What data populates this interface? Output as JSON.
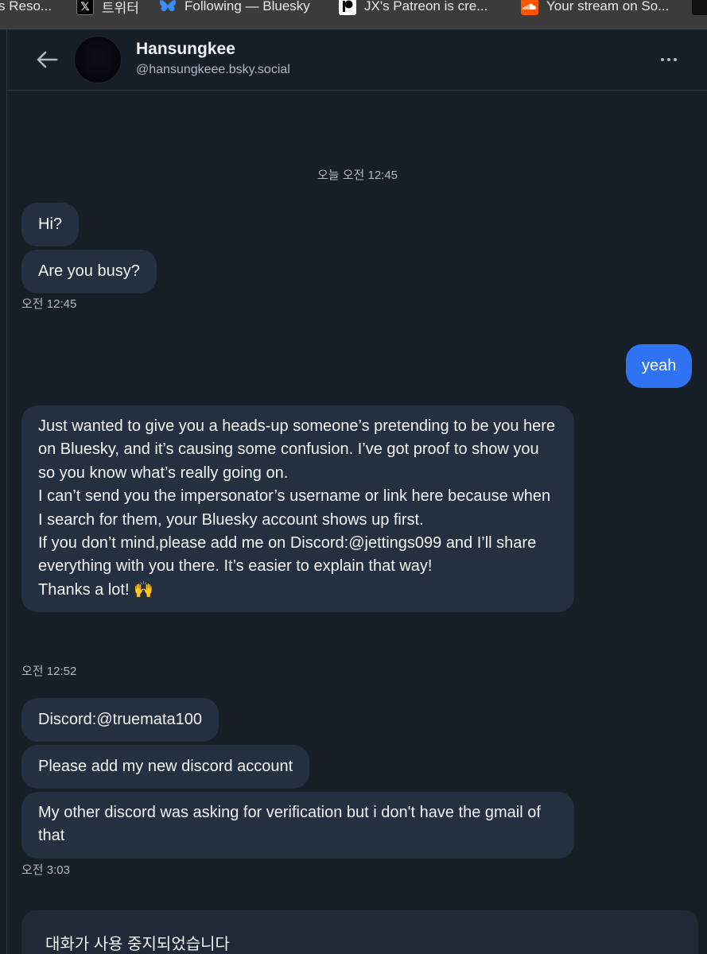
{
  "bookmarks": [
    {
      "label": "s Reso...",
      "icon": "dark-icon"
    },
    {
      "label": "트위터",
      "icon": "x-logo-icon"
    },
    {
      "label": "Following — Bluesky",
      "icon": "butterfly-icon"
    },
    {
      "label": "JX's Patreon is cre...",
      "icon": "patreon-icon"
    },
    {
      "label": "Your stream on So...",
      "icon": "soundcloud-icon"
    },
    {
      "label": "",
      "icon": "dark-icon"
    }
  ],
  "header": {
    "display_name": "Hansungkee",
    "handle": "@hansungkeee.bsky.social"
  },
  "conversation": {
    "date_divider": "오늘 오전 12:45",
    "messages": [
      {
        "from": "them",
        "text": "Hi?"
      },
      {
        "from": "them",
        "text": "Are you busy?"
      },
      {
        "from": "me",
        "text": "yeah"
      },
      {
        "from": "them",
        "text": "Just wanted to give you a heads-up someone’s pretending to be you here on Bluesky, and it’s causing some confusion. I’ve got proof to show you so you know what’s really going on.\nI can’t send you the impersonator’s username or link here because when I search for them, your Bluesky account shows up first.\nIf you don’t mind,please add me on Discord:@jettings099 and I’ll share everything with you there. It’s easier to explain that way!\nThanks a lot! 🙌"
      },
      {
        "from": "them",
        "text": "Discord:@truemata100"
      },
      {
        "from": "them",
        "text": "Please add my new discord account"
      },
      {
        "from": "them",
        "text": "My other discord was asking for verification but i don't have the gmail of that"
      }
    ],
    "timestamps": [
      "오전 12:45",
      "오전 12:52",
      "오전 3:03"
    ],
    "disabled_notice": "대화가 사용 중지되었습니다"
  },
  "colors": {
    "background": "#161e27",
    "bubble_them": "#243040",
    "bubble_me": "#2f73f3",
    "muted_text": "#aeb8c6"
  }
}
